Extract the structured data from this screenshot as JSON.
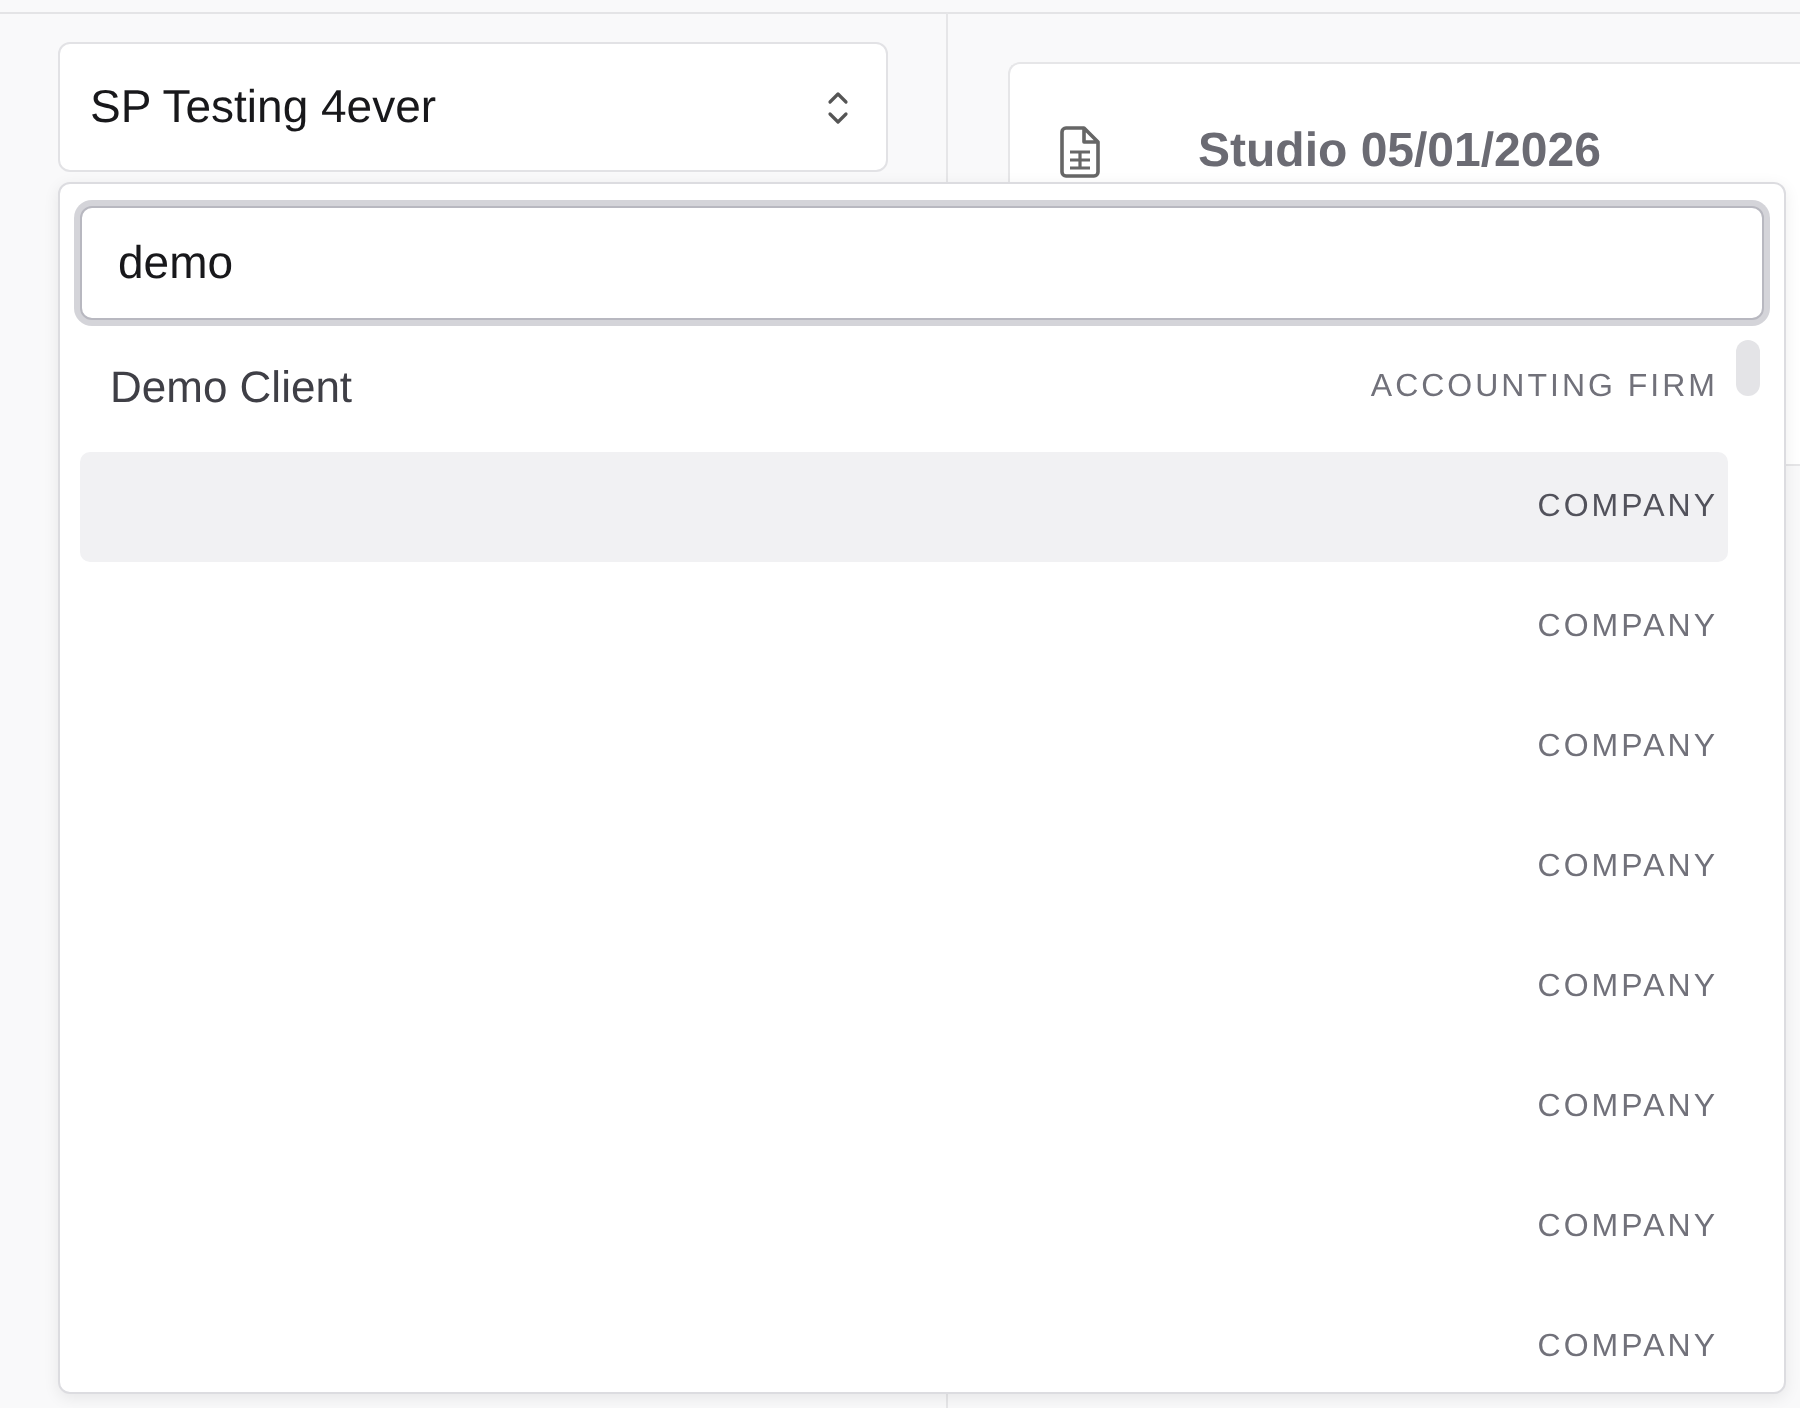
{
  "organization_select": {
    "value": "SP Testing 4ever"
  },
  "document_card": {
    "title": "Studio 05/01/2026"
  },
  "client_search": {
    "value": "demo",
    "results": [
      {
        "name": "Demo Client",
        "type": "ACCOUNTING FIRM",
        "selected": false
      },
      {
        "type": "COMPANY",
        "selected": true
      },
      {
        "type": "COMPANY",
        "selected": false
      },
      {
        "type": "COMPANY",
        "selected": false
      },
      {
        "type": "COMPANY",
        "selected": false
      },
      {
        "type": "COMPANY",
        "selected": false
      },
      {
        "type": "COMPANY",
        "selected": false
      },
      {
        "type": "COMPANY",
        "selected": false
      },
      {
        "type": "COMPANY",
        "selected": false
      }
    ]
  }
}
